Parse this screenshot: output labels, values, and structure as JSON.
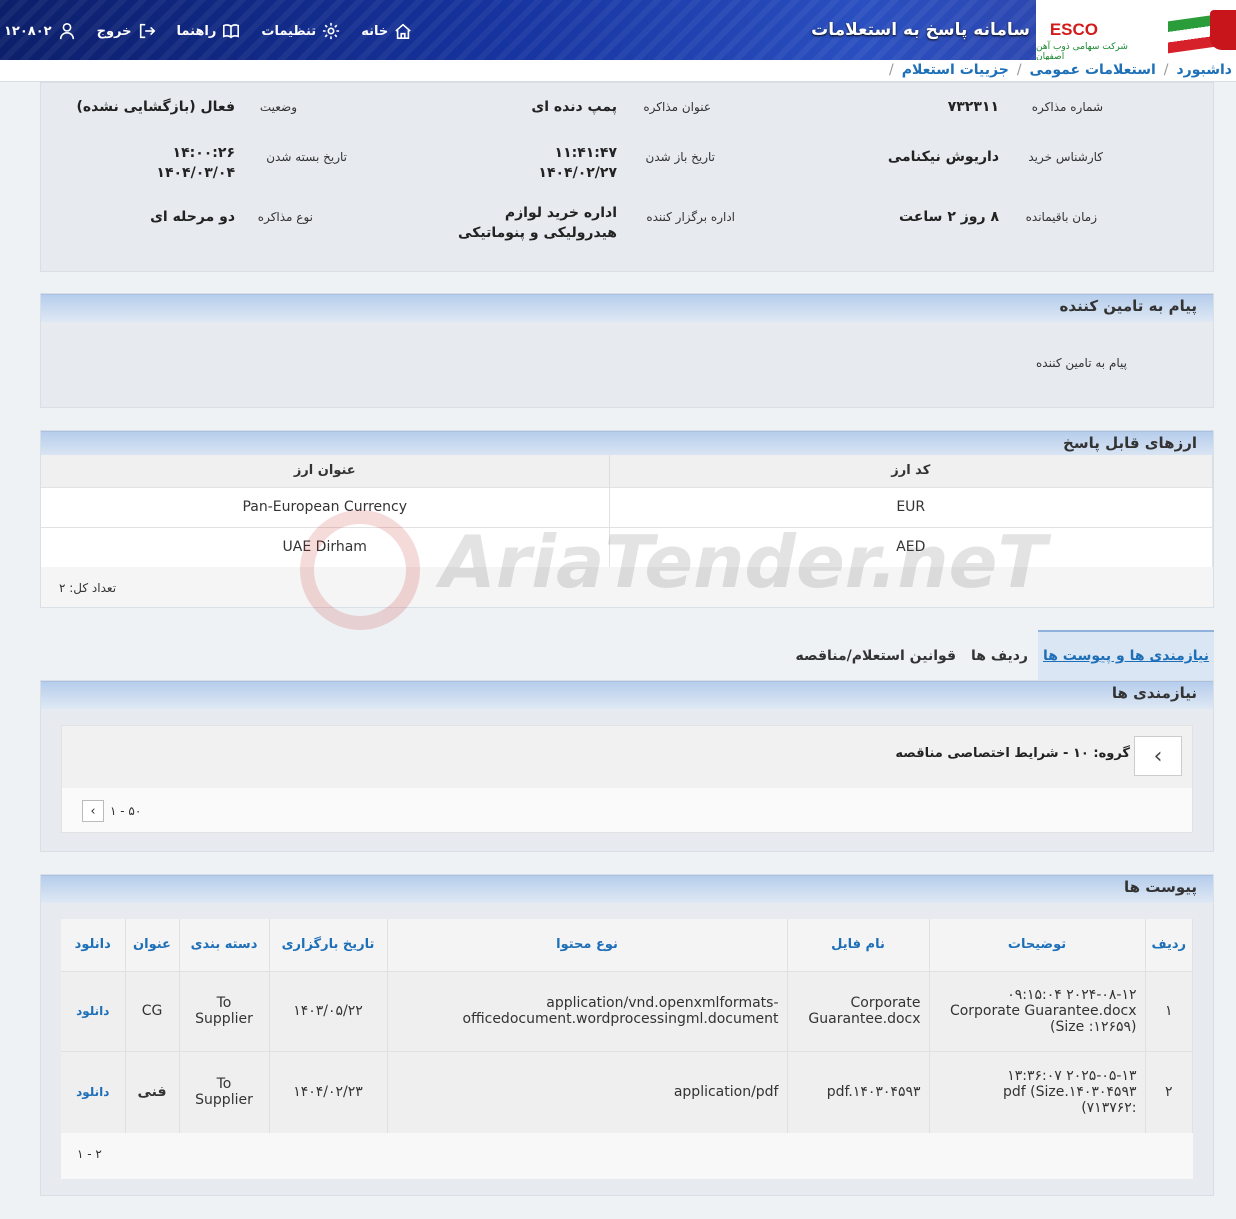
{
  "header": {
    "system_title": "سامانه پاسخ به استعلامات",
    "logo_text": "ESCO",
    "logo_subtitle": "شرکت سهامی ذوب آهن اصفهان",
    "nav": {
      "home": "خانه",
      "settings": "تنظیمات",
      "guide": "راهنما",
      "logout": "خروج",
      "user_id": "۱۲۰۸۰۲"
    }
  },
  "breadcrumb": [
    "داشبورد",
    "استعلامات عمومی",
    "جزییات استعلام"
  ],
  "info": {
    "negotiation_number_label": "شماره مذاکره",
    "negotiation_number": "۷۳۲۳۱۱",
    "title_label": "عنوان مذاکره",
    "title": "پمپ دنده ای",
    "status_label": "وضعیت",
    "status": "فعال (بازگشایی نشده)",
    "buyer_label": "کارشناس خرید",
    "buyer": "داریوش نیکنامی",
    "open_date_label": "تاریخ باز شدن",
    "open_time": "۱۱:۴۱:۴۷",
    "open_date": "۱۴۰۴/۰۲/۲۷",
    "close_date_label": "تاریخ بسته شدن",
    "close_time": "۱۴:۰۰:۲۶",
    "close_date": "۱۴۰۴/۰۳/۰۴",
    "remaining_label": "زمان باقیمانده",
    "remaining": "۸ روز ۲ ساعت",
    "organizer_label": "اداره برگزار کننده",
    "organizer": "اداره خرید لوازم هیدرولیکی و پنوماتیکی",
    "type_label": "نوع مذاکره",
    "type": "دو مرحله ای"
  },
  "supplier_message": {
    "title": "پیام به تامین کننده",
    "label": "پیام به تامین کننده"
  },
  "currencies": {
    "title": "ارزهای قابل پاسخ",
    "columns": [
      "کد ارز",
      "عنوان ارز"
    ],
    "rows": [
      {
        "code": "EUR",
        "name": "Pan-European Currency"
      },
      {
        "code": "AED",
        "name": "UAE Dirham"
      }
    ],
    "total": "تعداد کل: ۲"
  },
  "tabs": {
    "needs": "نیازمندی ها و پیوست ها",
    "items": "ردیف ها",
    "rules": "قوانین استعلام/مناقصه"
  },
  "needs": {
    "title": "نیازمندی ها",
    "group": "گروه: ۱۰ - شرایط اختصاصی مناقصه",
    "pager": "۱ - ۵۰"
  },
  "attachments": {
    "title": "پیوست ها",
    "columns": [
      "ردیف",
      "توضیحات",
      "نام فایل",
      "نوع محتوا",
      "تاریخ بارگزاری",
      "دسته بندی",
      "عنوان",
      "دانلود"
    ],
    "rows": [
      {
        "index": "۱",
        "desc_line1": "۲۰۲۴-۰۸-۱۲ ۰۹:۱۵:۰۴",
        "desc_line2": "Corporate Guarantee.docx",
        "desc_line3": "(Size :۱۲۶۵۹)",
        "file_name": "Corporate Guarantee.docx",
        "content_type": "application/vnd.openxmlformats-officedocument.wordprocessingml.document",
        "upload_date": "۱۴۰۳/۰۵/۲۲",
        "category": "To Supplier",
        "title": "CG",
        "download": "دانلود"
      },
      {
        "index": "۲",
        "desc_line1": "۲۰۲۵-۰۵-۱۳ ۱۳:۳۶:۰۷",
        "desc_line2": "pdf (Size.۱۴۰۳۰۴۵۹۳",
        "desc_line3": ":۷۱۳۷۶۲)",
        "file_name": "pdf.۱۴۰۳۰۴۵۹۳",
        "content_type": "application/pdf",
        "upload_date": "۱۴۰۴/۰۲/۲۳",
        "category": "To Supplier",
        "title": "فنی",
        "download": "دانلود"
      }
    ],
    "pager": "۱ - ۲"
  },
  "watermark": "AriaTender.neT",
  "colors": {
    "header": "#16339e",
    "accent": "#1d6fb8",
    "logo_red": "#d21c1c"
  }
}
